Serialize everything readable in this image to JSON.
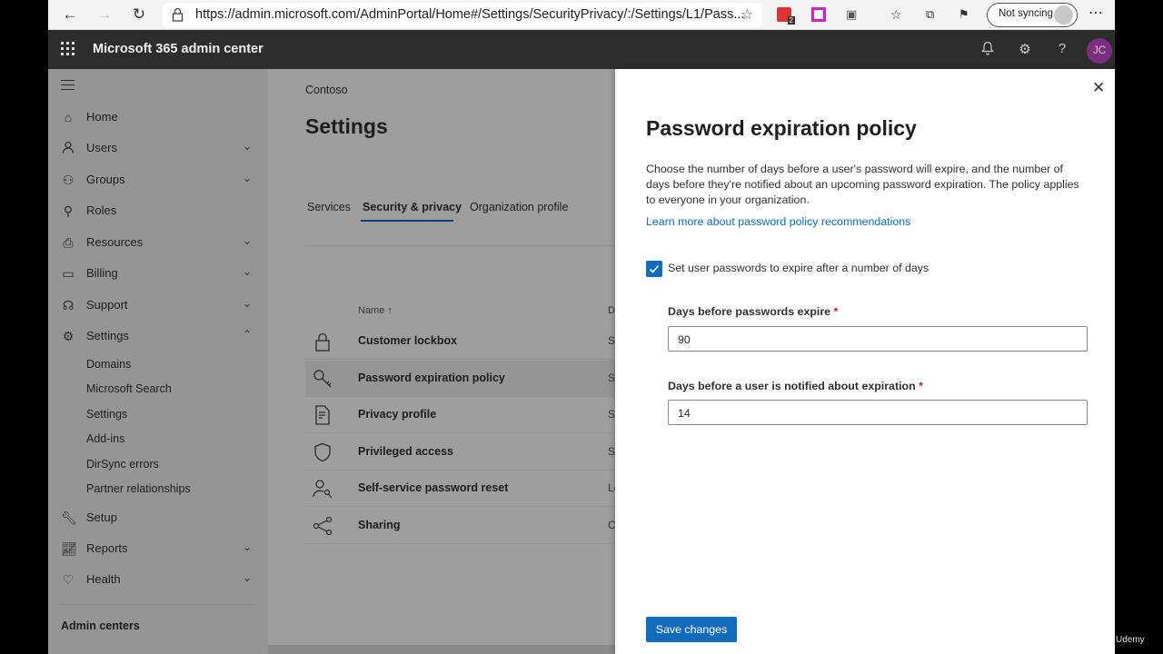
{
  "browser": {
    "url": "https://admin.microsoft.com/AdminPortal/Home#/Settings/SecurityPrivacy/:/Settings/L1/Pass...",
    "sync_label": "Not syncing",
    "ext_badge": "2"
  },
  "app": {
    "title": "Microsoft 365 admin center",
    "avatar_initials": "JC"
  },
  "sidebar": {
    "items": [
      {
        "label": "Home",
        "icon": "home-icon"
      },
      {
        "label": "Users",
        "icon": "user-icon",
        "expandable": true
      },
      {
        "label": "Groups",
        "icon": "groups-icon",
        "expandable": true
      },
      {
        "label": "Roles",
        "icon": "roles-icon"
      },
      {
        "label": "Resources",
        "icon": "resources-icon",
        "expandable": true
      },
      {
        "label": "Billing",
        "icon": "billing-icon",
        "expandable": true
      },
      {
        "label": "Support",
        "icon": "headset-icon",
        "expandable": true
      },
      {
        "label": "Settings",
        "icon": "gear-icon",
        "expanded": true
      }
    ],
    "settings_subitems": [
      "Domains",
      "Microsoft Search",
      "Settings",
      "Add-ins",
      "DirSync errors",
      "Partner relationships"
    ],
    "items_after": [
      {
        "label": "Setup",
        "icon": "wrench-icon"
      },
      {
        "label": "Reports",
        "icon": "chart-icon",
        "expandable": true
      },
      {
        "label": "Health",
        "icon": "heart-icon",
        "expandable": true
      }
    ],
    "admin_centers_label": "Admin centers"
  },
  "main": {
    "breadcrumb": "Contoso",
    "title": "Settings",
    "tabs": [
      {
        "label": "Services",
        "active": false
      },
      {
        "label": "Security & privacy",
        "active": true
      },
      {
        "label": "Organization profile",
        "active": false
      }
    ],
    "column_name": "Name ↑",
    "column_desc": "D",
    "rows": [
      {
        "name": "Customer lockbox",
        "desc": "Se"
      },
      {
        "name": "Password expiration policy",
        "desc": "Se",
        "selected": true
      },
      {
        "name": "Privacy profile",
        "desc": "Se"
      },
      {
        "name": "Privileged access",
        "desc": "Se"
      },
      {
        "name": "Self-service password reset",
        "desc": "Le"
      },
      {
        "name": "Sharing",
        "desc": "Cl"
      }
    ]
  },
  "panel": {
    "title": "Password expiration policy",
    "description": "Choose the number of days before a user's password will expire, and the number of days before they're notified about an upcoming password expiration. The policy applies to everyone in your organization.",
    "learn_more": "Learn more about password policy recommendations",
    "checkbox_label": "Set user passwords to expire after a number of days",
    "checkbox_checked": true,
    "field1_label": "Days before passwords expire",
    "field1_value": "90",
    "field2_label": "Days before a user is notified about expiration",
    "field2_value": "14",
    "required_marker": "*",
    "save_label": "Save changes"
  },
  "watermark": "Udemy",
  "colors": {
    "accent": "#0f6cbd",
    "header_bg": "#2d2d2d",
    "avatar_bg": "#7a2e7e"
  }
}
